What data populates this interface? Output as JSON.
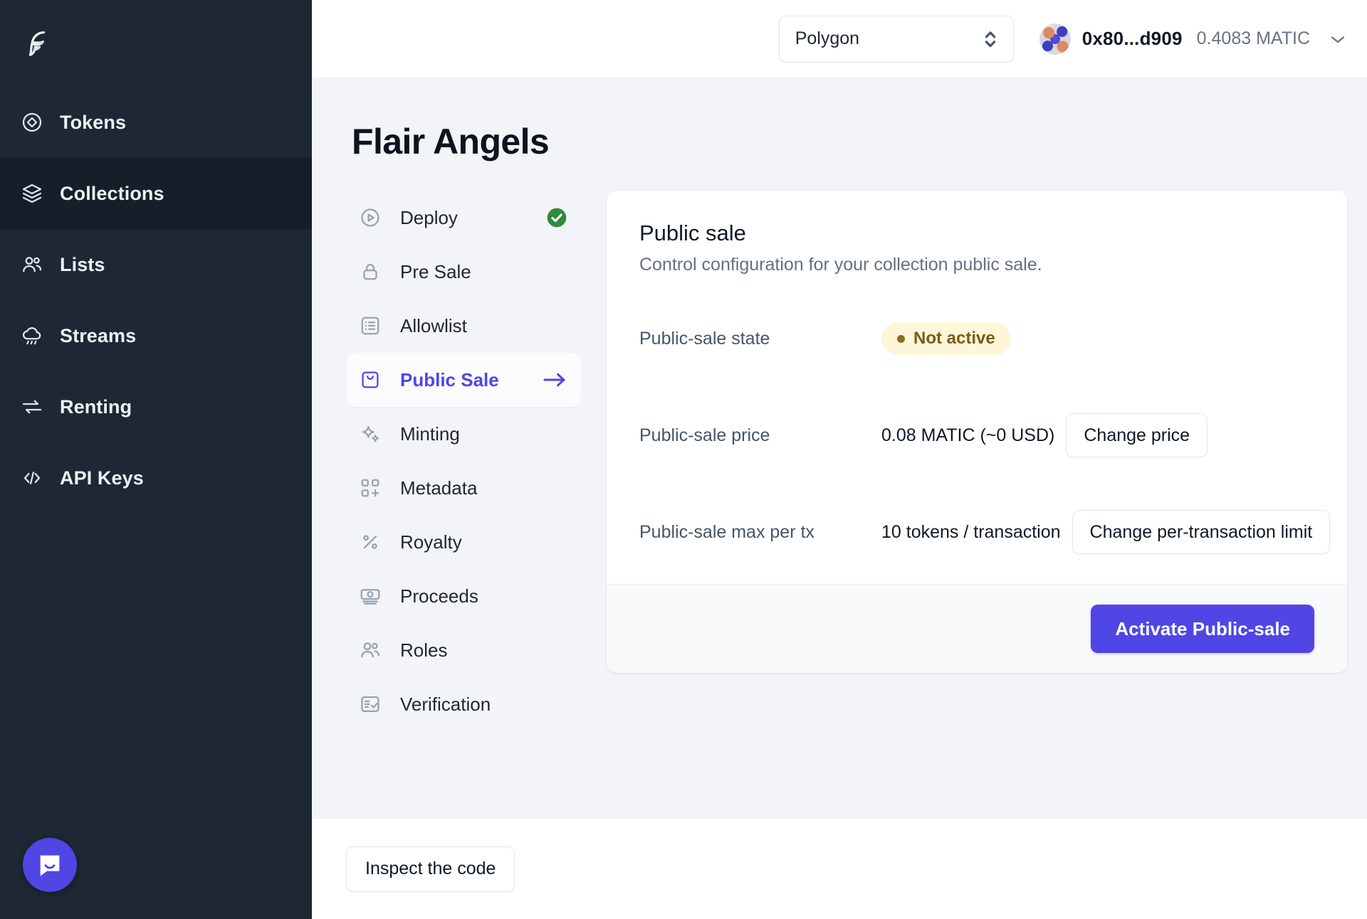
{
  "brand": {
    "logo_name": "flair-logo"
  },
  "sidebar": {
    "items": [
      {
        "label": "Tokens",
        "icon": "tokens-icon",
        "active": false
      },
      {
        "label": "Collections",
        "icon": "collections-icon",
        "active": true
      },
      {
        "label": "Lists",
        "icon": "lists-icon",
        "active": false
      },
      {
        "label": "Streams",
        "icon": "streams-icon",
        "active": false
      },
      {
        "label": "Renting",
        "icon": "renting-icon",
        "active": false
      },
      {
        "label": "API Keys",
        "icon": "api-keys-icon",
        "active": false
      }
    ],
    "support_widget": "intercom-chat-icon"
  },
  "topbar": {
    "network": {
      "value": "Polygon",
      "icon": "chevron-up-down-icon"
    },
    "wallet": {
      "address": "0x80...d909",
      "balance": "0.4083 MATIC",
      "avatar": "wallet-avatar",
      "chevron": "chevron-down-icon"
    }
  },
  "page": {
    "title": "Flair Angels"
  },
  "steps": [
    {
      "label": "Deploy",
      "icon": "deploy-icon",
      "state": "done",
      "trailing": "check-circle-icon"
    },
    {
      "label": "Pre Sale",
      "icon": "lock-icon",
      "state": "default",
      "trailing": ""
    },
    {
      "label": "Allowlist",
      "icon": "list-icon",
      "state": "default",
      "trailing": ""
    },
    {
      "label": "Public Sale",
      "icon": "public-sale-icon",
      "state": "current",
      "trailing": "arrow-right-icon"
    },
    {
      "label": "Minting",
      "icon": "sparkles-icon",
      "state": "default",
      "trailing": ""
    },
    {
      "label": "Metadata",
      "icon": "metadata-icon",
      "state": "default",
      "trailing": ""
    },
    {
      "label": "Royalty",
      "icon": "percent-icon",
      "state": "default",
      "trailing": ""
    },
    {
      "label": "Proceeds",
      "icon": "banknote-icon",
      "state": "default",
      "trailing": ""
    },
    {
      "label": "Roles",
      "icon": "users-icon",
      "state": "default",
      "trailing": ""
    },
    {
      "label": "Verification",
      "icon": "verification-icon",
      "state": "default",
      "trailing": ""
    }
  ],
  "card": {
    "title": "Public sale",
    "subtitle": "Control configuration for your collection public sale.",
    "rows": {
      "state": {
        "label": "Public-sale state",
        "badge": "Not active"
      },
      "price": {
        "label": "Public-sale price",
        "value": "0.08 MATIC (~0 USD)",
        "action": "Change price"
      },
      "max_per_tx": {
        "label": "Public-sale max per tx",
        "value": "10 tokens / transaction",
        "action": "Change per-transaction limit"
      }
    },
    "primary_action": "Activate Public-sale"
  },
  "bottombar": {
    "inspect_label": "Inspect the code"
  },
  "colors": {
    "sidebar_bg": "#1e2834",
    "sidebar_active_bg": "#161e29",
    "accent": "#4f46e5",
    "canvas": "#f2f4f7",
    "badge_bg": "#fdf6d9",
    "badge_text": "#7a5b18",
    "success": "#2f8a3e"
  }
}
